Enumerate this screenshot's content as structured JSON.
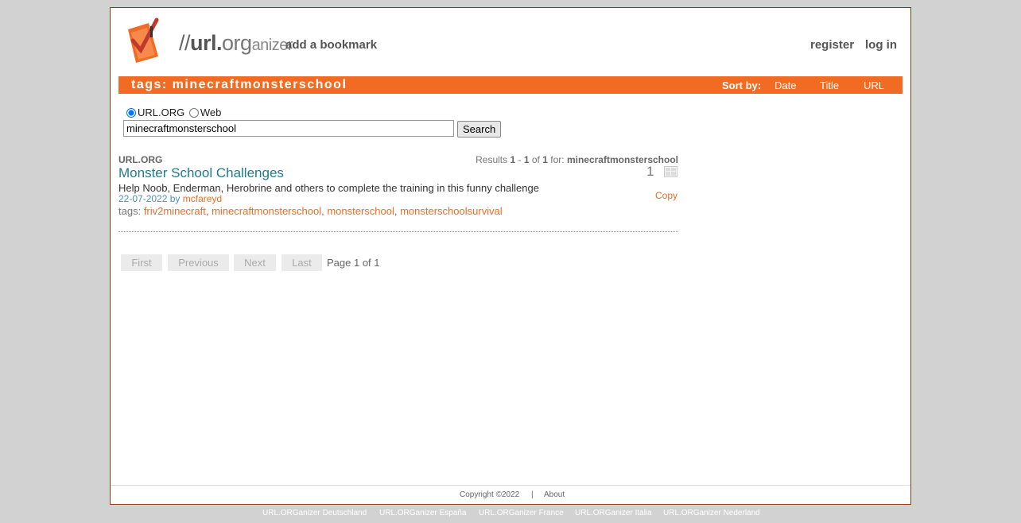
{
  "header": {
    "logo": {
      "prefix": "//",
      "url": "url.",
      "org": "org",
      "suffix": "anizer"
    },
    "add_bookmark": "add a bookmark",
    "register": "register",
    "login": "log in"
  },
  "tagbar": {
    "title": "tags: minecraftmonsterschool",
    "sort_label": "Sort by:",
    "sort_options": [
      "Date",
      "Title",
      "URL"
    ]
  },
  "search": {
    "radio_options": [
      "URL.ORG",
      "Web"
    ],
    "selected": "URL.ORG",
    "query": "minecraftmonsterschool",
    "button": "Search"
  },
  "results": {
    "source": "URL.ORG",
    "summary": {
      "prefix": "Results",
      "from": "1",
      "dash": "-",
      "to": "1",
      "of": "of",
      "total": "1",
      "for": "for:",
      "query": "minecraftmonsterschool"
    },
    "items": [
      {
        "title": "Monster School Challenges",
        "description": "Help Noob, Enderman, Herobrine and others to complete the training in this funny challenge",
        "date": "22-07-2022",
        "by": "by",
        "user": "mcfareyd",
        "count": "1",
        "copy": "Copy",
        "tags_label": "tags:",
        "tags": [
          "friv2minecraft",
          "minecraftmonsterschool",
          "monsterschool",
          "monsterschoolsurvival"
        ]
      }
    ]
  },
  "pagination": {
    "first": "First",
    "previous": "Previous",
    "next": "Next",
    "last": "Last",
    "info": "Page 1 of 1"
  },
  "footer": {
    "copyright": "Copyright ©2022",
    "separator": "|",
    "about": "About",
    "sites": [
      "URL.ORGanizer Deutschland",
      "URL.ORGanizer España",
      "URL.ORGanizer France",
      "URL.ORGanizer Italia",
      "URL.ORGanizer Nederland"
    ]
  },
  "colors": {
    "accent": "#f26b23",
    "link_orange": "#e76e2a",
    "title_teal": "#1f7b8d",
    "background": "#d2d2d2"
  }
}
